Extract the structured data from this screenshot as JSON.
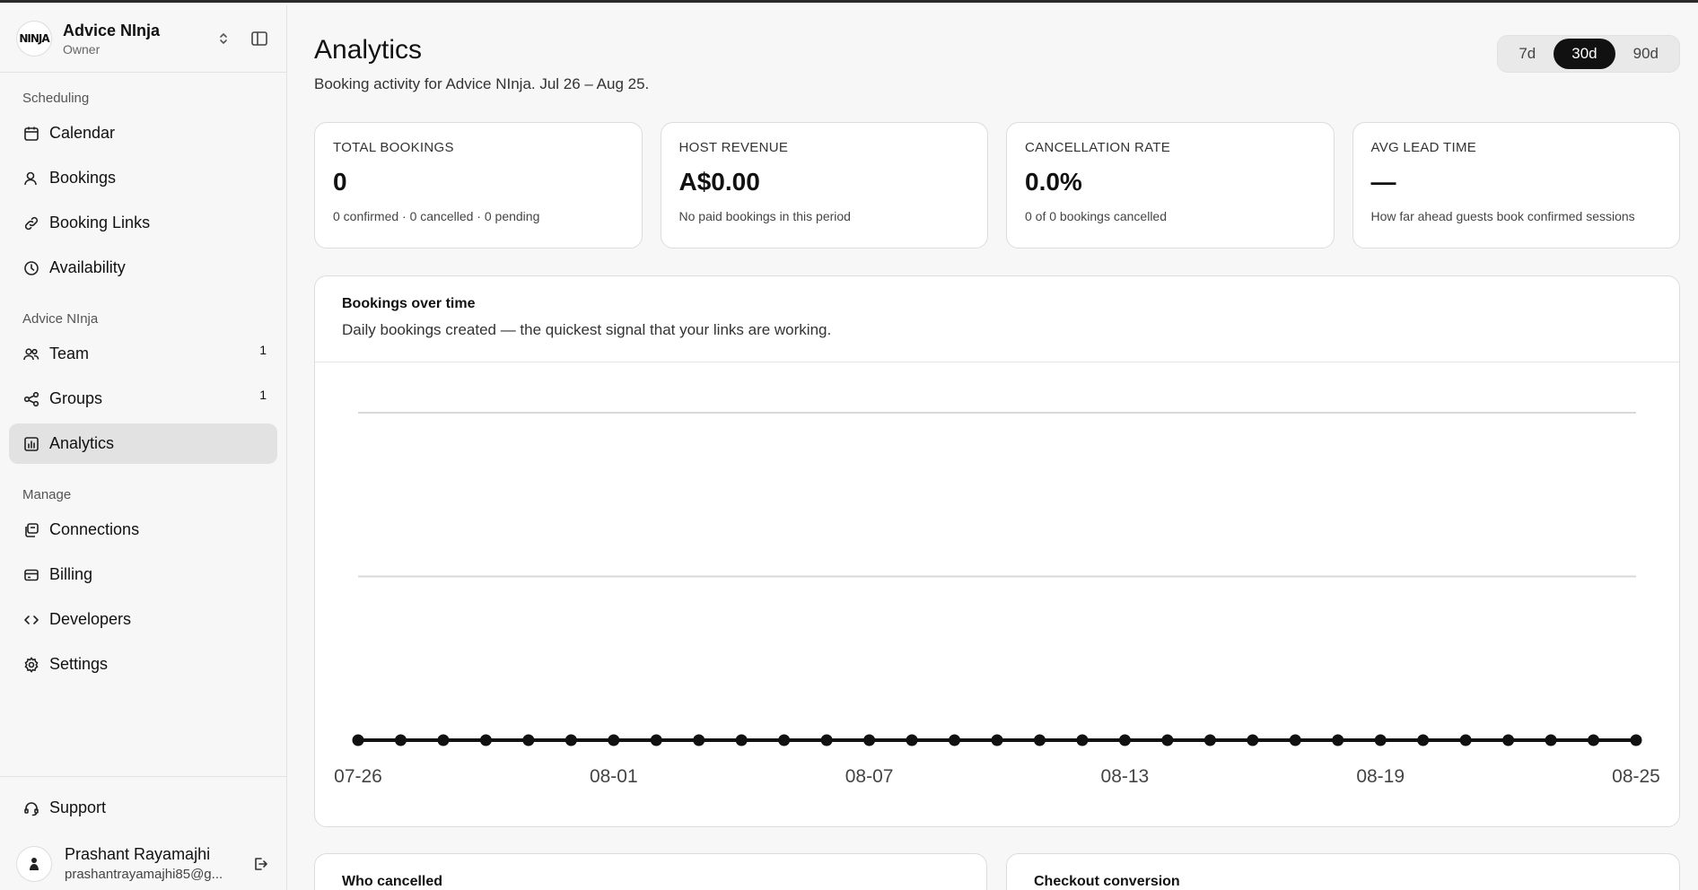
{
  "org": {
    "name": "Advice NInja",
    "role": "Owner",
    "logo_text": "NINJA"
  },
  "sidebar": {
    "sections": [
      {
        "label": "Scheduling"
      },
      {
        "label": "Advice NInja"
      },
      {
        "label": "Manage"
      }
    ],
    "items": [
      {
        "label": "Calendar",
        "icon": "calendar-icon"
      },
      {
        "label": "Bookings",
        "icon": "user-icon"
      },
      {
        "label": "Booking Links",
        "icon": "link-icon"
      },
      {
        "label": "Availability",
        "icon": "clock-icon"
      },
      {
        "label": "Team",
        "icon": "team-icon",
        "badge": "1"
      },
      {
        "label": "Groups",
        "icon": "share-icon",
        "badge": "1"
      },
      {
        "label": "Analytics",
        "icon": "bar-chart-icon",
        "active": true
      },
      {
        "label": "Connections",
        "icon": "connections-icon"
      },
      {
        "label": "Billing",
        "icon": "credit-card-icon"
      },
      {
        "label": "Developers",
        "icon": "code-icon"
      },
      {
        "label": "Settings",
        "icon": "gear-icon"
      }
    ],
    "support_label": "Support"
  },
  "user": {
    "name": "Prashant Rayamajhi",
    "email": "prashantrayamajhi85@g..."
  },
  "page": {
    "title": "Analytics",
    "subtitle": "Booking activity for Advice NInja. Jul 26 – Aug 25."
  },
  "range": {
    "options": [
      "7d",
      "30d",
      "90d"
    ],
    "selected": "30d"
  },
  "kpis": [
    {
      "label": "TOTAL BOOKINGS",
      "value": "0",
      "note": "0 confirmed · 0 cancelled · 0 pending"
    },
    {
      "label": "HOST REVENUE",
      "value": "A$0.00",
      "note": "No paid bookings in this period"
    },
    {
      "label": "CANCELLATION RATE",
      "value": "0.0%",
      "note": "0 of 0 bookings cancelled"
    },
    {
      "label": "AVG LEAD TIME",
      "value": "—",
      "note": "How far ahead guests book confirmed sessions"
    }
  ],
  "chart": {
    "title": "Bookings over time",
    "description": "Daily bookings created — the quickest signal that your links are working."
  },
  "chart_data": {
    "type": "line",
    "x": [
      "07-26",
      "07-27",
      "07-28",
      "07-29",
      "07-30",
      "07-31",
      "08-01",
      "08-02",
      "08-03",
      "08-04",
      "08-05",
      "08-06",
      "08-07",
      "08-08",
      "08-09",
      "08-10",
      "08-11",
      "08-12",
      "08-13",
      "08-14",
      "08-15",
      "08-16",
      "08-17",
      "08-18",
      "08-19",
      "08-20",
      "08-21",
      "08-22",
      "08-23",
      "08-24",
      "08-25"
    ],
    "x_tick_labels": [
      "07-26",
      "08-01",
      "08-07",
      "08-13",
      "08-19",
      "08-25"
    ],
    "series": [
      {
        "values": [
          0,
          0,
          0,
          0,
          0,
          0,
          0,
          0,
          0,
          0,
          0,
          0,
          0,
          0,
          0,
          0,
          0,
          0,
          0,
          0,
          0,
          0,
          0,
          0,
          0,
          0,
          0,
          0,
          0,
          0,
          0
        ]
      }
    ],
    "grid": true,
    "colors": {
      "line": "#111111",
      "grid": "#d9d9d9"
    }
  },
  "bottom_cards": [
    {
      "title": "Who cancelled"
    },
    {
      "title": "Checkout conversion"
    }
  ]
}
